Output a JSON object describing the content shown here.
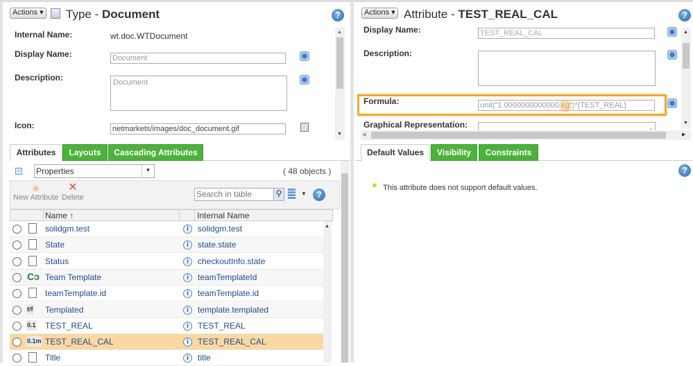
{
  "left": {
    "actions_label": "Actions",
    "title_prefix": "Type - ",
    "title_name": "Document",
    "fields": {
      "internal_name_label": "Internal Name:",
      "internal_name_value": "wt.doc.WTDocument",
      "display_name_label": "Display Name:",
      "display_name_value": "Document",
      "description_label": "Description:",
      "description_value": "Document",
      "icon_label": "Icon:",
      "icon_value": "netmarkets/images/doc_document.gif"
    },
    "tabs": [
      {
        "label": "Attributes",
        "active": true
      },
      {
        "label": "Layouts"
      },
      {
        "label": "Cascading Attributes"
      }
    ],
    "view_select": "Properties",
    "object_count": "( 48 objects )",
    "toolbar": {
      "new_attribute": "New Attribute",
      "delete": "Delete",
      "search_placeholder": "Search in table"
    },
    "columns": {
      "name": "Name",
      "name_sort": "↑",
      "internal_name": "Internal Name"
    },
    "rows": [
      {
        "name": "solidgm.test",
        "internal": "solidgm.test",
        "icon": "document-icon"
      },
      {
        "name": "State",
        "internal": "state.state",
        "icon": "document-icon"
      },
      {
        "name": "Status",
        "internal": "checkoutInfo.state",
        "icon": "document-icon"
      },
      {
        "name": "Team Template",
        "internal": "teamTemplateId",
        "icon": "team-template-icon"
      },
      {
        "name": "teamTemplate.id",
        "internal": "teamTemplate.id",
        "icon": "document-icon"
      },
      {
        "name": "Templated",
        "internal": "template.templated",
        "icon": "boolean-icon",
        "icon_text": "t/f"
      },
      {
        "name": "TEST_REAL",
        "internal": "TEST_REAL",
        "icon": "real-number-icon",
        "icon_text": "0.1"
      },
      {
        "name": "TEST_REAL_CAL",
        "internal": "TEST_REAL_CAL",
        "icon": "real-unit-icon",
        "icon_text": "0.1m",
        "selected": true
      },
      {
        "name": "Title",
        "internal": "title",
        "icon": "document-icon"
      }
    ]
  },
  "right": {
    "actions_label": "Actions",
    "title_prefix": "Attribute - ",
    "title_name": "TEST_REAL_CAL",
    "fields": {
      "display_name_label": "Display Name:",
      "display_name_value": "TEST_REAL_CAL",
      "description_label": "Description:",
      "description_value": "",
      "formula_label": "Formula:",
      "formula_value": "unit(\"1.0000000000000 kg\")*(TEST_REAL)",
      "graphical_label": "Graphical Representation:"
    },
    "tabs": [
      {
        "label": "Default Values",
        "active": true
      },
      {
        "label": "Visibility"
      },
      {
        "label": "Constraints"
      }
    ],
    "message": "This attribute does not support default values."
  },
  "colors": {
    "tab_green": "#4db23c",
    "selected_row": "#fbd7a2",
    "highlight": "#f0a830"
  },
  "help_glyph": "?"
}
